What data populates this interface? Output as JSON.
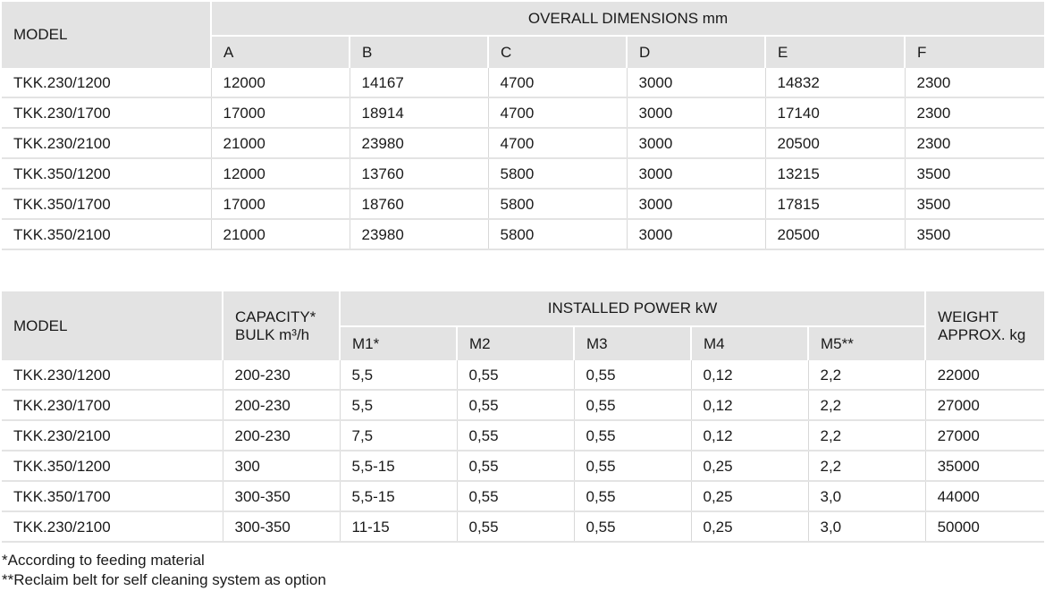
{
  "dimensions_table": {
    "model_header": "MODEL",
    "group_header": "OVERALL DIMENSIONS mm",
    "columns": [
      "A",
      "B",
      "C",
      "D",
      "E",
      "F"
    ],
    "rows": [
      [
        "TKK.230/1200",
        "12000",
        "14167",
        "4700",
        "3000",
        "14832",
        "2300"
      ],
      [
        "TKK.230/1700",
        "17000",
        "18914",
        "4700",
        "3000",
        "17140",
        "2300"
      ],
      [
        "TKK.230/2100",
        "21000",
        "23980",
        "4700",
        "3000",
        "20500",
        "2300"
      ],
      [
        "TKK.350/1200",
        "12000",
        "13760",
        "5800",
        "3000",
        "13215",
        "3500"
      ],
      [
        "TKK.350/1700",
        "17000",
        "18760",
        "5800",
        "3000",
        "17815",
        "3500"
      ],
      [
        "TKK.350/2100",
        "21000",
        "23980",
        "5800",
        "3000",
        "20500",
        "3500"
      ]
    ]
  },
  "power_table": {
    "model_header": "MODEL",
    "capacity_header_line1": "CAPACITY*",
    "capacity_header_line2": "BULK m³/h",
    "group_header": "INSTALLED POWER kW",
    "columns": [
      "M1*",
      "M2",
      "M3",
      "M4",
      "M5**"
    ],
    "weight_header_line1": "WEIGHT",
    "weight_header_line2": "APPROX. kg",
    "rows": [
      [
        "TKK.230/1200",
        "200-230",
        "5,5",
        "0,55",
        "0,55",
        "0,12",
        "2,2",
        "22000"
      ],
      [
        "TKK.230/1700",
        "200-230",
        "5,5",
        "0,55",
        "0,55",
        "0,12",
        "2,2",
        "27000"
      ],
      [
        "TKK.230/2100",
        "200-230",
        "7,5",
        "0,55",
        "0,55",
        "0,12",
        "2,2",
        "27000"
      ],
      [
        "TKK.350/1200",
        "300",
        "5,5-15",
        "0,55",
        "0,55",
        "0,25",
        "2,2",
        "35000"
      ],
      [
        "TKK.350/1700",
        "300-350",
        "5,5-15",
        "0,55",
        "0,55",
        "0,25",
        "3,0",
        "44000"
      ],
      [
        "TKK.230/2100",
        "300-350",
        "11-15",
        "0,55",
        "0,55",
        "0,25",
        "3,0",
        "50000"
      ]
    ]
  },
  "notes": [
    "*According to feeding material",
    "**Reclaim belt for self cleaning system as option"
  ]
}
